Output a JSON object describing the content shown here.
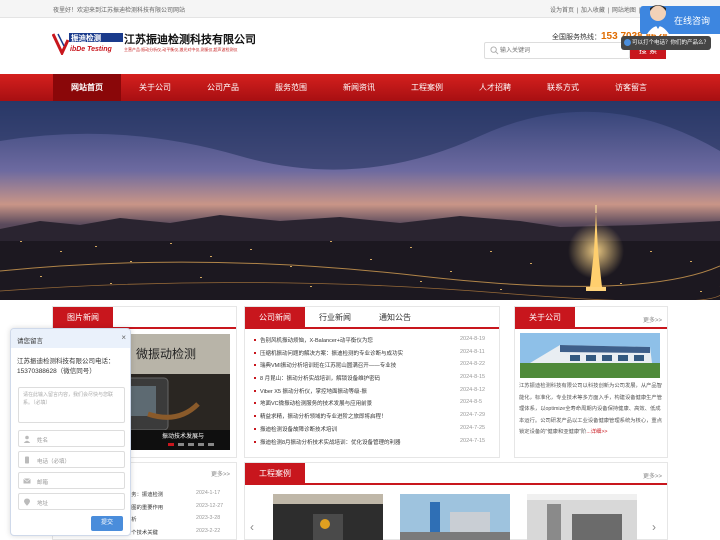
{
  "topbar": {
    "welcome": "夜里好！欢迎来到江苏振迪检测科技有限公司网站",
    "links": [
      "设为首页",
      "|",
      "加入收藏",
      "|",
      "网站地图",
      "|"
    ]
  },
  "header": {
    "logo_cn": "振迪检测",
    "logo_en": "ibDe Testing",
    "company_name": "江苏振迪检测科技有限公司",
    "slogan": "主营产品:振动分析仪,动平衡仪,激光对中仪,测振仪,超声波检测仪",
    "hotline_label": "全国服务热线：",
    "hotline_number": "153 7038 8628",
    "search_placeholder": "输入关键词",
    "search_button": "搜 索"
  },
  "nav": {
    "items": [
      "网站首页",
      "关于公司",
      "公司产品",
      "服务范围",
      "新闻资讯",
      "工程案例",
      "人才招聘",
      "联系方式",
      "访客留言"
    ],
    "active_index": 0
  },
  "photo_news": {
    "title": "图片新闻",
    "image_caption": "振动技术发展与",
    "image_text": "微振动检测"
  },
  "news": {
    "tabs": [
      "公司新闻",
      "行业新闻",
      "通知公告"
    ],
    "more": "更多>>",
    "items": [
      {
        "title": "告别风机振动烦恼，X-Balancer+动平衡仪为您",
        "date": "2024-8-19"
      },
      {
        "title": "压缩机振动问题的解决方案：振迪检测的专业诊断与成功实",
        "date": "2024-8-11"
      },
      {
        "title": "瑞典VMI振动分析培训班在江苏昆山圆满召开——专业技",
        "date": "2024-8-22"
      },
      {
        "title": "8 月昆山：振动分析实战培训，解锁设备维护密码",
        "date": "2024-8-15"
      },
      {
        "title": "Viber X5 振动分析仪，掌控地面振动等级-振",
        "date": "2024-8-12"
      },
      {
        "title": "地面VC微振动检测服务的技术发展与应用前景",
        "date": "2024-8-5"
      },
      {
        "title": "精益求精，振动分析领域的专业进阶之旅即将启程！",
        "date": "2024-7-29"
      },
      {
        "title": "振迪检测设备故障诊断技术培训",
        "date": "2024-7-25"
      },
      {
        "title": "振迪检测8月振动分析技术实战培训：优化设备管理的利器",
        "date": "2024-7-15"
      }
    ]
  },
  "about": {
    "title": "关于公司",
    "more": "更多>>",
    "text": "江苏振迪检测科技有限公司以科技创新为公司发展，从产品智能化，标准化，专业技术等多方面入手，构建设备健康生产管理体系，以optimize全寿命周期内设备保持健康、高效、低成本运行。公司研发产品以工业设备健康管理系统为核心，重点锁定设备的\"健康和亚健康\"阶",
    "link": "...详细>>"
  },
  "industry_news": {
    "more": "更多>>",
    "items": [
      {
        "title": "服务：振迪检测",
        "date": "2024-1-17"
      },
      {
        "title": "速图的重要作用",
        "date": "2023-12-27"
      },
      {
        "title": "分析",
        "date": "2023-3-28"
      },
      {
        "title": "析个技术关键",
        "date": "2023-2-22"
      }
    ]
  },
  "cases": {
    "title": "工程案例",
    "more": "更多>>"
  },
  "message_panel": {
    "title": "请您留言",
    "close": "×",
    "intro": "江苏振迪检测科技有限公司电话：15370388628（微信同号）",
    "textarea_placeholder": "请在此输入留言内容，我们会尽快与您联系。（必填）",
    "fields": [
      "姓名",
      "电话（必填）",
      "邮箱",
      "地址"
    ],
    "submit": "提交"
  },
  "consult": {
    "label": "在线咨询",
    "bubble": "可以打个电话？你们的产品么？"
  }
}
